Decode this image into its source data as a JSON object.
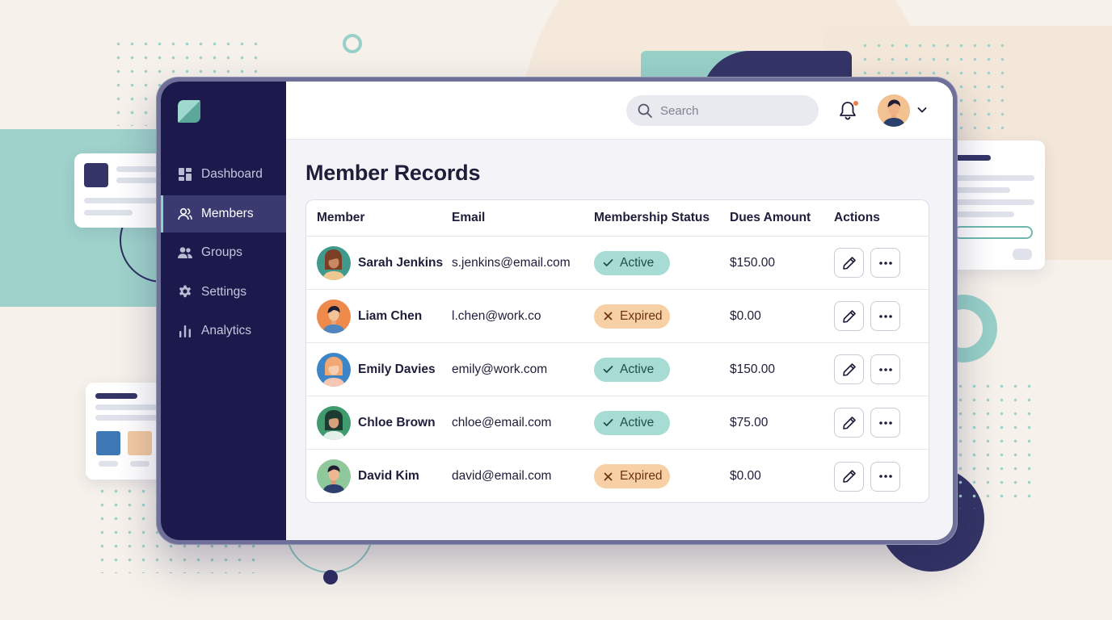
{
  "search": {
    "placeholder": "Search"
  },
  "sidebar": {
    "items": [
      {
        "label": "Dashboard",
        "icon": "dashboard-icon",
        "active": false
      },
      {
        "label": "Members",
        "icon": "members-icon",
        "active": true
      },
      {
        "label": "Groups",
        "icon": "groups-icon",
        "active": false
      },
      {
        "label": "Settings",
        "icon": "gear-icon",
        "active": false
      },
      {
        "label": "Analytics",
        "icon": "bar-chart-icon",
        "active": false
      }
    ]
  },
  "main": {
    "title": "Member Records",
    "table": {
      "headers": [
        "Member",
        "Email",
        "Membership Status",
        "Dues Amount",
        "Actions"
      ],
      "rows": [
        {
          "name": "Sarah Jenkins",
          "email": "s.jenkins@email.com",
          "status": "Active",
          "dues": "$150.00"
        },
        {
          "name": "Liam Chen",
          "email": "l.chen@work.co",
          "status": "Expired",
          "dues": "$0.00"
        },
        {
          "name": "Emily Davies",
          "email": "emily@work.com",
          "status": "Active",
          "dues": "$150.00"
        },
        {
          "name": "Chloe Brown",
          "email": "chloe@email.com",
          "status": "Active",
          "dues": "$75.00"
        },
        {
          "name": "David Kim",
          "email": "david@email.com",
          "status": "Expired",
          "dues": "$0.00"
        }
      ]
    }
  },
  "colors": {
    "sidebar_bg": "#1c1a4d",
    "active_badge": "#a6dcd4",
    "expired_badge": "#f8d0a6",
    "accent_teal": "#8fd3c8",
    "notification_dot": "#ee7d4a"
  }
}
